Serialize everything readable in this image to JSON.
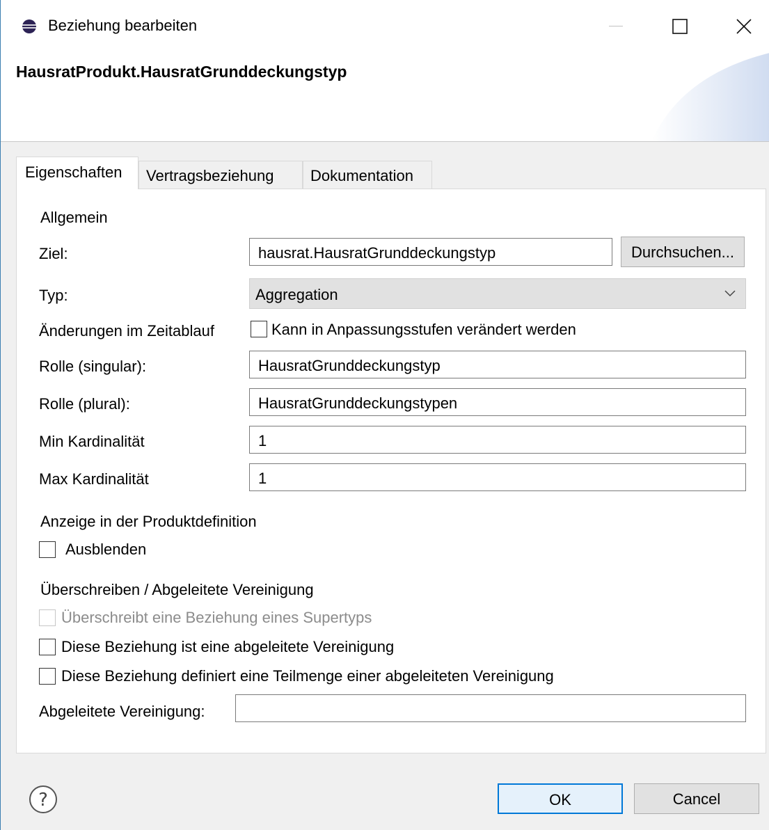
{
  "window": {
    "title": "Beziehung bearbeiten",
    "header_title": "HausratProdukt.HausratGrunddeckungstyp"
  },
  "tabs": [
    {
      "label": "Eigenschaften",
      "active": true
    },
    {
      "label": "Vertragsbeziehung",
      "active": false
    },
    {
      "label": "Dokumentation",
      "active": false
    }
  ],
  "general": {
    "section_label": "Allgemein",
    "target_label": "Ziel:",
    "target_value": "hausrat.HausratGrunddeckungstyp",
    "browse_label": "Durchsuchen...",
    "type_label": "Typ:",
    "type_value": "Aggregation",
    "changes_label": "Änderungen im Zeitablauf",
    "changes_checkbox_label": "Kann in Anpassungsstufen verändert werden",
    "role_singular_label": "Rolle (singular):",
    "role_singular_value": "HausratGrunddeckungstyp",
    "role_plural_label": "Rolle (plural):",
    "role_plural_value": "HausratGrunddeckungstypen",
    "min_card_label": "Min Kardinalität",
    "min_card_value": "1",
    "max_card_label": "Max Kardinalität",
    "max_card_value": "1"
  },
  "display": {
    "section_label": "Anzeige in der Produktdefinition",
    "hide_label": "Ausblenden"
  },
  "override": {
    "section_label": "Überschreiben / Abgeleitete Vereinigung",
    "overrides_label": "Überschreibt eine Beziehung eines Supertyps",
    "derived_union_label": "Diese Beziehung ist eine abgeleitete Vereinigung",
    "subset_label": "Diese Beziehung definiert eine Teilmenge einer abgeleiteten Vereinigung",
    "derived_union_field_label": "Abgeleitete Vereinigung:",
    "derived_union_field_value": ""
  },
  "footer": {
    "ok_label": "OK",
    "cancel_label": "Cancel"
  },
  "colors": {
    "accent": "#0078d7",
    "window_bg": "#f0f0f0",
    "panel_bg": "#ffffff"
  },
  "icons": {
    "app": "eclipse-icon",
    "help": "help-question-icon",
    "dropdown": "chevron-down-icon"
  }
}
